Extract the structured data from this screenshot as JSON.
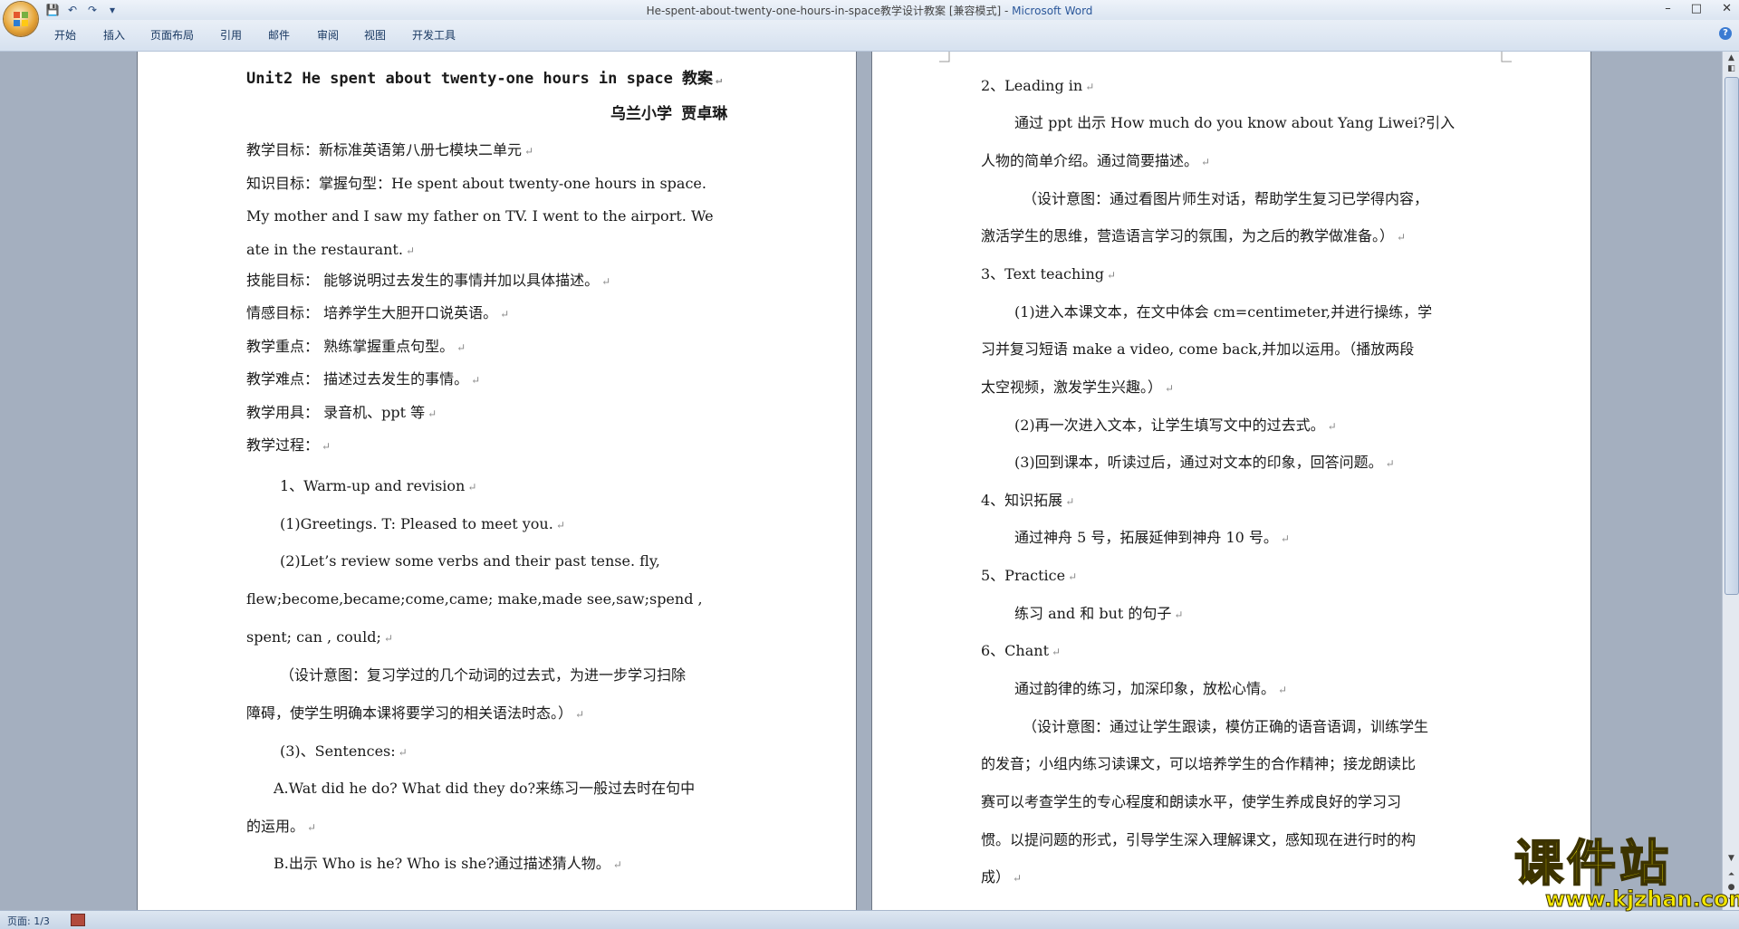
{
  "window": {
    "title": "He-spent-about-twenty-one-hours-in-space教学设计教案 [兼容模式] - ",
    "app_name": "Microsoft Word"
  },
  "ribbon": {
    "tabs": [
      "开始",
      "插入",
      "页面布局",
      "引用",
      "邮件",
      "审阅",
      "视图",
      "开发工具"
    ]
  },
  "status": {
    "page": "页面: 1/3"
  },
  "left_page": {
    "title": "Unit2 He spent about twenty-one hours in space 教案",
    "author": "乌兰小学 贾卓琳",
    "lines": [
      "教学目标：新标准英语第八册七模块二单元",
      "知识目标：掌握句型：He spent about twenty-one hours in space.",
      "My mother and I saw my father on TV. I went to the airport. We",
      "ate in the restaurant.",
      "技能目标： 能够说明过去发生的事情并加以具体描述。",
      "情感目标： 培养学生大胆开口说英语。",
      "教学重点： 熟练掌握重点句型。",
      "教学难点： 描述过去发生的事情。",
      "教学用具： 录音机、ppt 等",
      "教学过程：",
      "1、Warm-up and revision",
      "(1)Greetings. T: Pleased to meet you.",
      "(2)Let’s  review some verbs and their past tense.  fly,",
      "flew;become,became;come,came;  make,made  see,saw;spend ,",
      "spent; can , could;",
      "（设计意图：复习学过的几个动词的过去式，为进一步学习扫除",
      "障碍，使学生明确本课将要学习的相关语法时态。）",
      "(3)、Sentences:",
      "A.Wat did he do? What did they do?来练习一般过去时在句中",
      "的运用。",
      "B.出示 Who is he? Who is she?通过描述猜人物。"
    ]
  },
  "right_page": {
    "lines": [
      "2、Leading in",
      "通过 ppt 出示 How much do you know about Yang Liwei?引入",
      "人物的简单介绍。通过简要描述。",
      "（设计意图：通过看图片师生对话，帮助学生复习已学得内容，",
      "激活学生的思维，营造语言学习的氛围，为之后的教学做准备。）",
      "3、Text teaching",
      "(1)进入本课文本，在文中体会 cm=centimeter,并进行操练，学",
      "习并复习短语 make a video, come back,并加以运用。（播放两段",
      "太空视频，激发学生兴趣。）",
      "(2)再一次进入文本，让学生填写文中的过去式。",
      "(3)回到课本，听读过后，通过对文本的印象，回答问题。",
      "4、知识拓展",
      "通过神舟 5 号，拓展延伸到神舟 10 号。",
      "5、Practice",
      "练习 and 和 but 的句子",
      "6、Chant",
      "通过韵律的练习，加深印象，放松心情。",
      "（设计意图：通过让学生跟读，模仿正确的语音语调，训练学生",
      "的发音；小组内练习读课文，可以培养学生的合作精神；接龙朗读比",
      "赛可以考查学生的专心程度和朗读水平，使学生养成良好的学习习",
      "惯。以提问题的形式，引导学生深入理解课文，感知现在进行时的构",
      "成）"
    ]
  },
  "watermark": {
    "text": "课件站",
    "url": "www.kjzhan.com"
  }
}
